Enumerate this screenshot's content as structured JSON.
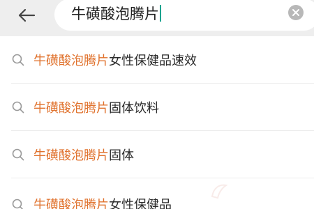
{
  "search": {
    "query": "牛磺酸泡腾片"
  },
  "icons": {
    "back": "arrow-left-icon",
    "clear": "close-circle-icon",
    "suggest": "search-icon"
  },
  "colors": {
    "highlight": "#e0722d",
    "caret": "#1aa38f"
  },
  "suggestions": [
    {
      "highlight": "牛磺酸泡腾片",
      "rest": "女性保健品速效"
    },
    {
      "highlight": "牛磺酸泡腾片",
      "rest": "固体饮料"
    },
    {
      "highlight": "牛磺酸泡腾片",
      "rest": "固体"
    },
    {
      "highlight": "牛磺酸泡腾片",
      "rest": "女性保健品"
    }
  ]
}
